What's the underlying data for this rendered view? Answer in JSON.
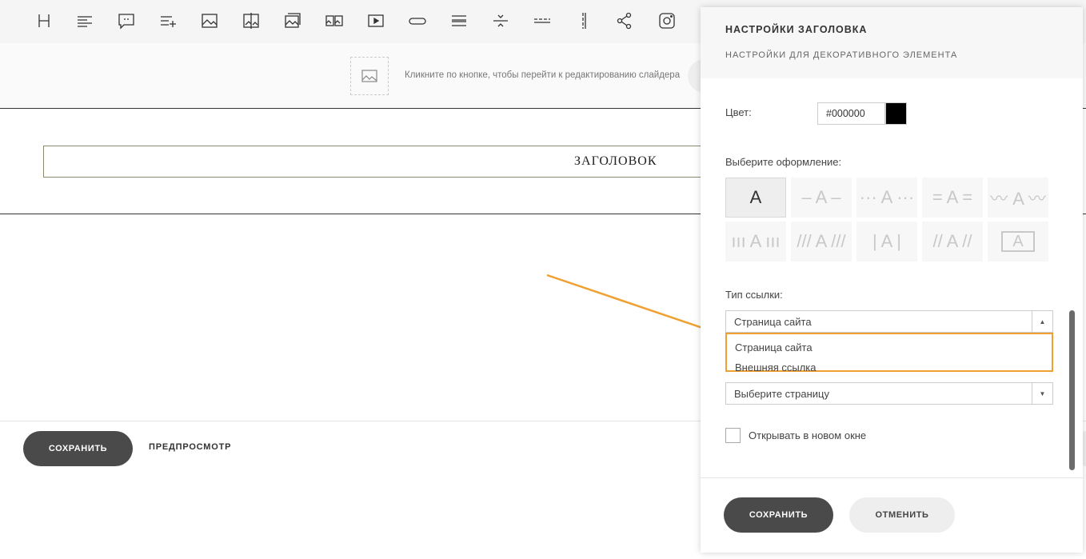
{
  "toolbar": {
    "icons": [
      "heading-icon",
      "text-icon",
      "quote-icon",
      "list-add-icon",
      "image-icon",
      "image-compare-icon",
      "gallery-icon",
      "double-image-icon",
      "video-icon",
      "button-icon",
      "lines-icon",
      "divider-icon",
      "dashed-divider-icon",
      "vertical-divider-icon",
      "share-icon",
      "instagram-icon"
    ]
  },
  "slider": {
    "hint": "Кликните по кнопке, чтобы перейти к редактированию слайдера"
  },
  "content": {
    "heading": "ЗАГОЛОВОК"
  },
  "footer": {
    "save_label": "СОХРАНИТЬ",
    "preview_label": "ПРЕДПРОСМОТР"
  },
  "panel": {
    "title": "НАСТРОЙКИ ЗАГОЛОВКА",
    "subtitle": "НАСТРОЙКИ ДЛЯ ДЕКОРАТИВНОГО ЭЛЕМЕНТА",
    "color_label": "Цвет:",
    "color_value": "#000000",
    "color_swatch": "#000000",
    "style_label": "Выберите оформление:",
    "styles": [
      "A",
      "– A –",
      "··· A ···",
      "= A =",
      "〰 A 〰",
      "ııı A ııı",
      "/// A ///",
      "| A |",
      "// A //",
      "A"
    ],
    "selected_style": 0,
    "link_type_label": "Тип ссылки:",
    "link_type_value": "Страница сайта",
    "link_type_options": [
      "Страница сайта",
      "Внешняя ссылка"
    ],
    "page_select_placeholder": "Выберите страницу",
    "new_window_label": "Открывать в новом окне",
    "save_label": "СОХРАНИТЬ",
    "cancel_label": "ОТМЕНИТЬ"
  },
  "colors": {
    "accent_highlight": "#f0a030",
    "dark_button": "#4a4a4a"
  }
}
